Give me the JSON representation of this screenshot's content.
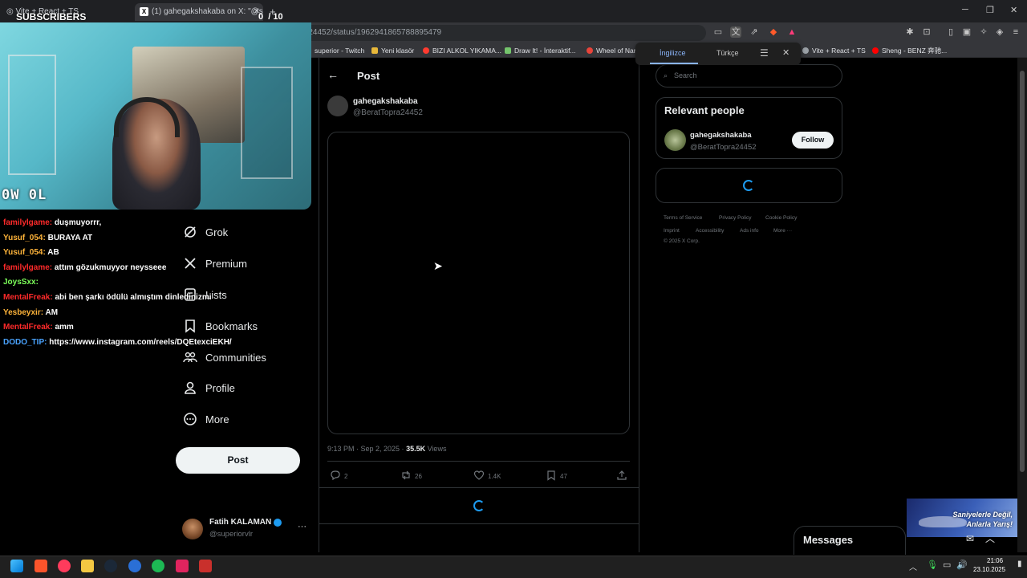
{
  "browser": {
    "tabs": [
      {
        "label": "Vite + React + TS"
      },
      {
        "label": "(1) gahegakshakaba on X: \"@sol"
      }
    ],
    "url": "x.com/BeratTopra24452/status/1962941865788895479",
    "bookmarks": [
      {
        "label": "superior - Twitch",
        "color": "#9146ff"
      },
      {
        "label": "Yeni klasör",
        "color": "#e8b83a"
      },
      {
        "label": "BIZI ALKOL YIKAMA...",
        "color": "#ff3b30"
      },
      {
        "label": "Draw It! - İnteraktif...",
        "color": "#74c46c"
      },
      {
        "label": "Wheel of Nar",
        "color": "#e8443a"
      },
      {
        "label": "Vite + React + TS",
        "color": "#9aa0a6"
      },
      {
        "label": "Sheng - BENZ 奔驰...",
        "color": "#ff0000"
      }
    ]
  },
  "translate_popup": {
    "lang_from": "İngilizce",
    "lang_to": "Türkçe"
  },
  "stream": {
    "subscribers_label": "SUBSCRIBERS",
    "goal_current": "0",
    "goal_total": "/ 10",
    "overlay_text": "0W 0L",
    "chat": [
      {
        "user": "familylgame:",
        "msg": "duşmuyorrr,",
        "color": "#ff2a2a"
      },
      {
        "user": "Yusuf_054:",
        "msg": "BURAYA AT",
        "color": "#ffb43a"
      },
      {
        "user": "Yusuf_054:",
        "msg": "AB",
        "color": "#ffb43a"
      },
      {
        "user": "familylgame:",
        "msg": "attım gözukmuyyor neysseee",
        "color": "#ff2a2a"
      },
      {
        "user": "JoysSxx:",
        "msg": "",
        "color": "#7dff5a"
      },
      {
        "user": "MentalFreak:",
        "msg": "abi ben şarkı ödülü almıştım dinledinizmi",
        "color": "#ff2a2a"
      },
      {
        "user": "Yesbeyxir:",
        "msg": "AM",
        "color": "#ffb43a"
      },
      {
        "user": "MentalFreak:",
        "msg": "amm",
        "color": "#ff2a2a"
      },
      {
        "user": "DODO_TIP:",
        "msg": "https://www.instagram.com/reels/DQEtexciEKH/",
        "color": "#4aa3ff"
      }
    ]
  },
  "nav": {
    "items": [
      {
        "label": "Grok",
        "icon": "grok-icon"
      },
      {
        "label": "Premium",
        "icon": "x-logo-icon"
      },
      {
        "label": "Lists",
        "icon": "list-icon"
      },
      {
        "label": "Bookmarks",
        "icon": "bookmark-icon"
      },
      {
        "label": "Communities",
        "icon": "communities-icon"
      },
      {
        "label": "Profile",
        "icon": "profile-icon"
      },
      {
        "label": "More",
        "icon": "more-circle-icon"
      }
    ],
    "post_button": "Post",
    "account": {
      "name": "Fatih KALAMAN",
      "handle": "@superiorvlr"
    }
  },
  "post": {
    "header_title": "Post",
    "author_name": "gahegakshakaba",
    "author_handle": "@BeratTopra24452",
    "timestamp": "9:13 PM · Sep 2, 2025 · ",
    "views_count": "35.5K",
    "views_label": " Views",
    "replies": "2",
    "reposts": "26",
    "likes": "1.4K",
    "bookmarks": "47"
  },
  "sidebar": {
    "search_placeholder": "Search",
    "relevant_title": "Relevant people",
    "person_name": "gahegakshakaba",
    "person_handle": "@BeratTopra24452",
    "follow_label": "Follow",
    "footer_links": [
      "Terms of Service",
      "Privacy Policy",
      "Cookie Policy",
      "Imprint",
      "Accessibility",
      "Ads info",
      "More ···"
    ],
    "copyright": "© 2025 X Corp."
  },
  "messages": {
    "label": "Messages"
  },
  "promo": {
    "line1": "Saniyelerle Değil,",
    "line2": "Anlarla Yarış!"
  },
  "taskbar": {
    "time": "21:06",
    "date": "23.10.2025"
  }
}
